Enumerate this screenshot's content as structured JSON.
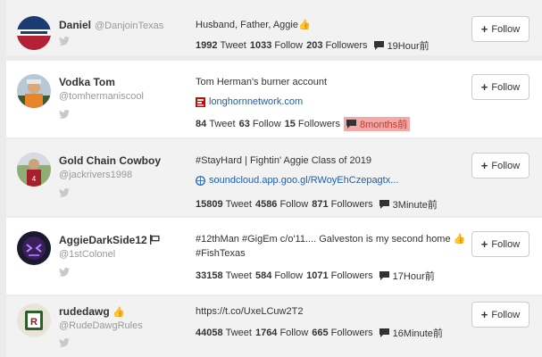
{
  "follow_label": "Follow",
  "stat_labels": {
    "tweet": "Tweet",
    "follow": "Follow",
    "followers": "Followers"
  },
  "colors": {
    "link": "#1a5fb4",
    "highlight": "#f4a9a9",
    "twitter_bird": "#c8c8c8"
  },
  "users": [
    {
      "name": "Daniel",
      "handle": "@DanjoinTexas",
      "bio": "Husband, Father, Aggie👍",
      "link": "",
      "tweets": "1992",
      "follows": "1033",
      "followers": "203",
      "time": "19Hour前"
    },
    {
      "name": "Vodka Tom",
      "handle": "@tomhermaniscool",
      "bio": "Tom Herman's burner account",
      "link": "longhornnetwork.com",
      "link_icon": "espn-icon",
      "tweets": "84",
      "follows": "63",
      "followers": "15",
      "time": "8months前"
    },
    {
      "name": "Gold Chain Cowboy",
      "handle": "@jackrivers1998",
      "bio": "#StayHard | Fightin' Aggie Class of 2019",
      "link": "soundcloud.app.goo.gl/RWoyEhCzepagtx...",
      "link_icon": "globe-icon",
      "tweets": "15809",
      "follows": "4586",
      "followers": "871",
      "time": "3Minute前"
    },
    {
      "name": "AggieDarkSide12",
      "handle": "@1stColonel",
      "bio": "#12thMan #GigEm c/o'11.... Galveston is my second home 👍",
      "bio2": "#FishTexas",
      "link": "",
      "tweets": "33158",
      "follows": "584",
      "followers": "1071",
      "time": "17Hour前"
    },
    {
      "name": "rudedawg",
      "name_emoji": "👍",
      "handle": "@RudeDawgRules",
      "bio": "https://t.co/UxeLCuw2T2",
      "link": "",
      "tweets": "44058",
      "follows": "1764",
      "followers": "665",
      "time": "16Minute前"
    }
  ]
}
